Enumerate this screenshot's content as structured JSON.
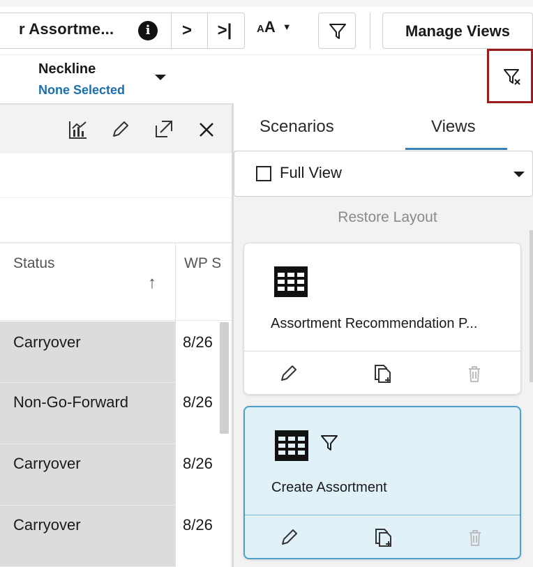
{
  "toolbar": {
    "context_title": "r Assortme...",
    "info_icon": "info-icon",
    "next_label": ">",
    "last_label": ">|",
    "font_small": "A",
    "font_large": "A",
    "filter_icon": "filter-icon",
    "manage_views_label": "Manage Views"
  },
  "filter_bar": {
    "field_label": "Neckline",
    "field_value": "None Selected",
    "clear_filter_icon": "clear-filter-icon"
  },
  "grid": {
    "tools": [
      "chart-icon",
      "edit-icon",
      "expand-icon",
      "close-icon"
    ],
    "columns": [
      {
        "label": "Status",
        "sort": "↑"
      },
      {
        "label": "WP S"
      }
    ],
    "rows": [
      {
        "status": "Carryover",
        "wp": "8/26"
      },
      {
        "status": "Non-Go-Forward",
        "wp": "8/26"
      },
      {
        "status": "Carryover",
        "wp": "8/26"
      },
      {
        "status": "Carryover",
        "wp": "8/26"
      }
    ]
  },
  "side_panel": {
    "tabs": [
      {
        "label": "Scenarios",
        "active": false
      },
      {
        "label": "Views",
        "active": true
      }
    ],
    "view_selector": {
      "label": "Full View",
      "checked": false
    },
    "restore_label": "Restore Layout",
    "cards": [
      {
        "title": "Assortment Recommendation P...",
        "icon": "table-icon",
        "filtered": false,
        "selected": false,
        "actions": [
          "edit-icon",
          "duplicate-icon",
          "delete-icon"
        ]
      },
      {
        "title": "Create Assortment",
        "icon": "table-icon",
        "filtered": true,
        "selected": true,
        "actions": [
          "edit-icon",
          "duplicate-icon",
          "delete-icon"
        ]
      }
    ]
  },
  "colors": {
    "accent": "#1a6fb0",
    "tab_underline": "#3a7fb5",
    "highlight_border": "#9b1c1c",
    "selected_card_bg": "#e0f1f8",
    "selected_card_border": "#4f9fc9"
  }
}
